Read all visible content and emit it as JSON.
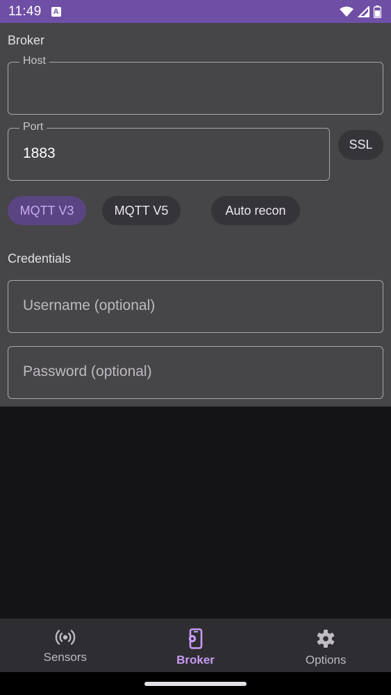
{
  "status_bar": {
    "time": "11:49",
    "notification_glyph": "A",
    "icons": [
      "wifi-icon",
      "signal-icon",
      "battery-icon"
    ]
  },
  "broker": {
    "section_title": "Broker",
    "host": {
      "label": "Host",
      "value": ""
    },
    "port": {
      "label": "Port",
      "value": "1883"
    },
    "ssl_label": "SSL",
    "chips": {
      "mqtt_v3": "MQTT V3",
      "mqtt_v5": "MQTT V5",
      "auto_recon": "Auto recon"
    },
    "selected_chip": "mqtt_v3"
  },
  "credentials": {
    "section_title": "Credentials",
    "username_placeholder": "Username (optional)",
    "password_placeholder": "Password (optional)"
  },
  "bottom_nav": {
    "sensors": "Sensors",
    "broker": "Broker",
    "options": "Options",
    "active": "broker"
  },
  "colors": {
    "status_bar": "#6f4fa6",
    "accent": "#c79bf5",
    "selected_chip_bg": "#5a4582",
    "panel": "#464548",
    "background": "#141316"
  }
}
